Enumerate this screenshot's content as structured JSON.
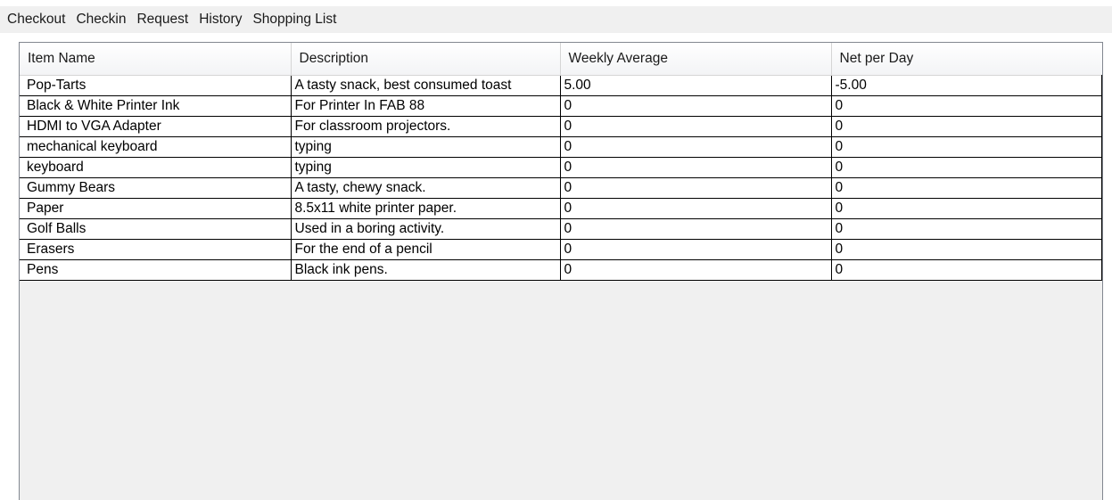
{
  "menu": {
    "items": [
      {
        "label": "Checkout"
      },
      {
        "label": "Checkin"
      },
      {
        "label": "Request"
      },
      {
        "label": "History"
      },
      {
        "label": "Shopping List"
      }
    ]
  },
  "grid": {
    "columns": [
      "Item Name",
      "Description",
      "Weekly Average",
      "Net per Day"
    ],
    "rows": [
      [
        "Pop-Tarts",
        "A tasty snack, best consumed toast",
        "5.00",
        "-5.00"
      ],
      [
        "Black & White Printer Ink",
        "For Printer In FAB 88",
        "0",
        "0"
      ],
      [
        "HDMI to VGA Adapter",
        "For classroom projectors.",
        "0",
        "0"
      ],
      [
        "mechanical keyboard",
        "typing",
        "0",
        "0"
      ],
      [
        "keyboard",
        "typing",
        "0",
        "0"
      ],
      [
        "Gummy Bears",
        "A tasty, chewy snack.",
        "0",
        "0"
      ],
      [
        "Paper",
        "8.5x11 white printer paper.",
        "0",
        "0"
      ],
      [
        "Golf Balls",
        "Used in a boring activity.",
        "0",
        "0"
      ],
      [
        "Erasers",
        "For the end of a pencil",
        "0",
        "0"
      ],
      [
        "Pens",
        "Black ink pens.",
        "0",
        "0"
      ]
    ]
  },
  "colors": {
    "menubar_bg": "#f0f0f0",
    "grid_background": "#f0f0f0",
    "cell_border": "#000000",
    "header_border": "#d5d5d5",
    "frame_border": "#828790"
  }
}
